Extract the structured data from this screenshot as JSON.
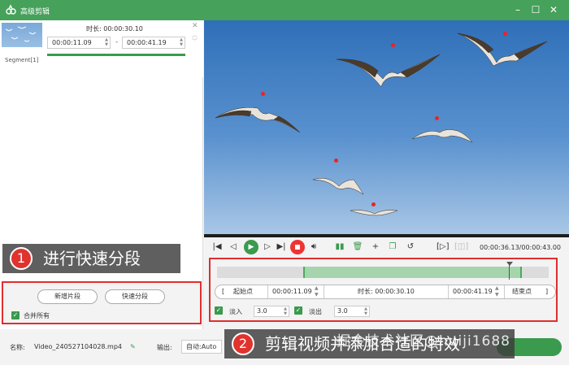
{
  "window": {
    "title": "高级剪辑",
    "min_icon": "minimize-icon",
    "max_icon": "maximize-icon",
    "close_icon": "close-icon"
  },
  "segment": {
    "duration_label": "时长: 00:00:30.10",
    "start": "00:00:11.09",
    "end": "00:00:41.19",
    "dash": "-",
    "name": "Segment[1]"
  },
  "buttons": {
    "new_segment": "新增片段",
    "quick_split": "快速分段",
    "merge_all": "合并所有"
  },
  "callouts": {
    "one_num": "1",
    "one_text": "进行快速分段",
    "two_num": "2",
    "two_text": "剪辑视频并添加合适的特效"
  },
  "player": {
    "time_readout": "00:00:36.13/00:00:43.00",
    "markers": [
      "1",
      "2",
      "3",
      "4",
      "5",
      "6"
    ]
  },
  "timeline": {
    "bracket_left": "[",
    "start_label": "起始点",
    "start_time": "00:00:11.09",
    "duration": "时长: 00:00:30.10",
    "end_time": "00:00:41.19",
    "end_label": "结束点",
    "bracket_right": "]",
    "fade_in_label": "淡入",
    "fade_in_value": "3.0",
    "fade_out_label": "淡出",
    "fade_out_value": "3.0",
    "selection_start": 0.26,
    "selection_end": 0.92,
    "playhead": 0.88
  },
  "bottom": {
    "name_label": "名称:",
    "file_name": "Video_240527104028.mp4",
    "output_label": "输出:",
    "output_value": "自动:Auto"
  },
  "watermark": "掘金技术社区@huiji1688",
  "colors": {
    "accent": "#46a15a",
    "highlight": "#e02e2e"
  }
}
